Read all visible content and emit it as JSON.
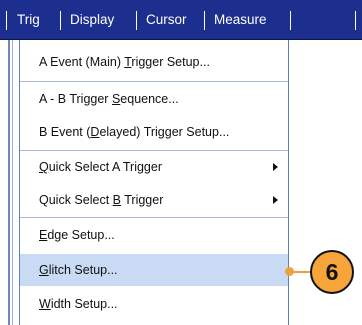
{
  "menubar": {
    "items": [
      {
        "label": "Trig"
      },
      {
        "label": "Display"
      },
      {
        "label": "Cursor"
      },
      {
        "label": "Measure"
      }
    ]
  },
  "dropdown": {
    "items": [
      {
        "pre": "A Event (Main) ",
        "ul": "T",
        "post": "rigger Setup..."
      },
      {
        "pre": "A - B Trigger ",
        "ul": "S",
        "post": "equence..."
      },
      {
        "pre": "B Event (",
        "ul": "D",
        "post": "elayed) Trigger Setup..."
      },
      {
        "pre": "",
        "ul": "Q",
        "post": "uick Select A Trigger",
        "submenu": true
      },
      {
        "pre": "Quick Select ",
        "ul": "B",
        "post": " Trigger",
        "submenu": true
      },
      {
        "pre": "",
        "ul": "E",
        "post": "dge Setup..."
      },
      {
        "pre": "",
        "ul": "G",
        "post": "litch Setup...",
        "highlighted": true
      },
      {
        "pre": "",
        "ul": "W",
        "post": "idth Setup..."
      }
    ]
  },
  "callout": {
    "number": "6",
    "color": "#f7a53a"
  },
  "colors": {
    "menubar_bg": "#1c2f8e",
    "highlight_bg": "#c9dbf4"
  }
}
